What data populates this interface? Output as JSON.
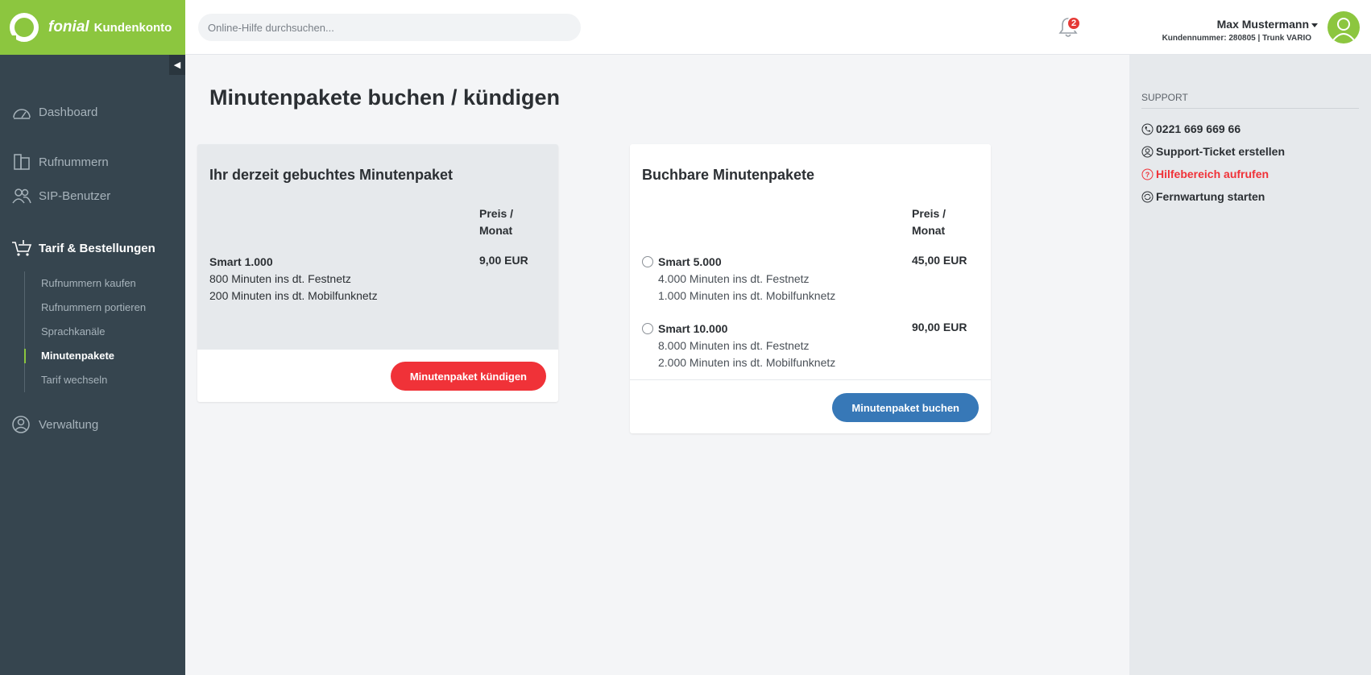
{
  "brand": {
    "name": "fonial",
    "product": "Kundenkonto"
  },
  "header": {
    "search_placeholder": "Online-Hilfe durchsuchen...",
    "notifications_count": "2",
    "user_name": "Max Mustermann",
    "user_meta": "Kundennummer: 280805 | Trunk VARIO"
  },
  "sidebar": {
    "collapse_label": "◀",
    "items": [
      {
        "label": "Dashboard",
        "icon": "gauge-icon"
      },
      {
        "label": "Rufnummern",
        "icon": "phone-icon"
      },
      {
        "label": "SIP-Benutzer",
        "icon": "users-icon"
      },
      {
        "label": "Tarif & Bestellungen",
        "icon": "cart-icon"
      },
      {
        "label": "Verwaltung",
        "icon": "user-circle-icon"
      }
    ],
    "subitems": [
      {
        "label": "Rufnummern kaufen"
      },
      {
        "label": "Rufnummern portieren"
      },
      {
        "label": "Sprachkanäle"
      },
      {
        "label": "Minutenpakete"
      },
      {
        "label": "Tarif wechseln"
      }
    ]
  },
  "main": {
    "title": "Minutenpakete buchen / kündigen",
    "current": {
      "title": "Ihr derzeit gebuchtes Minutenpaket",
      "price_head_1": "Preis /",
      "price_head_2": "Monat",
      "package": {
        "name": "Smart 1.000",
        "line1": "800 Minuten ins dt. Festnetz",
        "line2": "200 Minuten ins dt. Mobilfunknetz",
        "price": "9,00 EUR"
      },
      "cancel_label": "Minutenpaket kündigen"
    },
    "available": {
      "title": "Buchbare Minutenpakete",
      "price_head_1": "Preis /",
      "price_head_2": "Monat",
      "packages": [
        {
          "name": "Smart 5.000",
          "line1": "4.000 Minuten ins dt. Festnetz",
          "line2": "1.000 Minuten ins dt. Mobilfunknetz",
          "price": "45,00 EUR"
        },
        {
          "name": "Smart 10.000",
          "line1": "8.000 Minuten ins dt. Festnetz",
          "line2": "2.000 Minuten ins dt. Mobilfunknetz",
          "price": "90,00 EUR"
        }
      ],
      "book_label": "Minutenpaket buchen"
    }
  },
  "support": {
    "heading": "SUPPORT",
    "phone": "0221 669 669 66",
    "ticket": "Support-Ticket erstellen",
    "help": "Hilfebereich aufrufen",
    "remote": "Fernwartung starten"
  },
  "colors": {
    "brand_green": "#8cc63f",
    "sidebar": "#36454f",
    "danger": "#f03238",
    "primary": "#3778b7"
  }
}
